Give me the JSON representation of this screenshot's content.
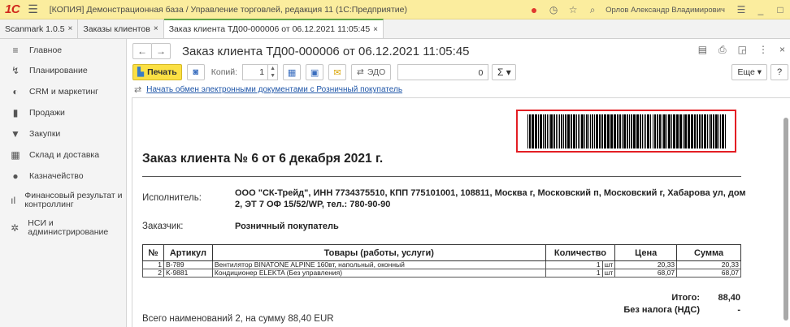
{
  "app": {
    "logo": "1С",
    "title": "[КОПИЯ] Демонстрационная база / Управление торговлей, редакция 11  (1С:Предприятие)",
    "user": "Орлов Александр Владимирович"
  },
  "tabs": [
    {
      "label": "Scanmark 1.0.5",
      "close": "×"
    },
    {
      "label": "Заказы клиентов",
      "close": "×"
    },
    {
      "label": "Заказ клиента ТД00-000006 от 06.12.2021 11:05:45",
      "close": "×"
    }
  ],
  "sidebar": {
    "items": [
      {
        "label": "Главное",
        "icon": "≡"
      },
      {
        "label": "Планирование",
        "icon": "↯"
      },
      {
        "label": "CRM и маркетинг",
        "icon": "◐"
      },
      {
        "label": "Продажи",
        "icon": "▮"
      },
      {
        "label": "Закупки",
        "icon": "▼"
      },
      {
        "label": "Склад и доставка",
        "icon": "▦"
      },
      {
        "label": "Казначейство",
        "icon": "●"
      },
      {
        "label": "Финансовый результат и контроллинг",
        "icon": "ıl"
      },
      {
        "label": "НСИ и администрирование",
        "icon": "✲"
      }
    ]
  },
  "doc": {
    "title": "Заказ клиента ТД00-000006 от 06.12.2021 11:05:45"
  },
  "toolbar": {
    "print_label": "Печать",
    "copies_label": "Копий:",
    "copies_value": "1",
    "edo_label": "ЭДО",
    "sum_value": "0",
    "sigma_label": "Σ ▾",
    "more_label": "Еще ▾",
    "help_label": "?"
  },
  "edo_link": "Начать обмен электронными документами с Розничный покупатель",
  "print": {
    "heading": "Заказ клиента № 6 от 6 декабря 2021 г.",
    "executor_label": "Исполнитель:",
    "executor_value": "ООО \"СК-Трейд\", ИНН 7734375510, КПП 775101001, 108811, Москва г, Московский п, Московский г, Хабарова ул, дом 2, ЭТ 7 ОФ 15/52/WP, тел.: 780-90-90",
    "customer_label": "Заказчик:",
    "customer_value": "Розничный покупатель",
    "table_headers": [
      "№",
      "Артикул",
      "Товары (работы, услуги)",
      "Количество",
      "Цена",
      "Сумма"
    ],
    "rows": [
      {
        "n": "1",
        "sku": "B-789",
        "name": "Вентилятор BINATONE ALPINE 160вт, напольный, оконный",
        "qty": "1",
        "unit": "шт",
        "price": "20,33",
        "sum": "20,33"
      },
      {
        "n": "2",
        "sku": "K-9881",
        "name": "Кондиционер ELEKTA (Без управления)",
        "qty": "1",
        "unit": "шт",
        "price": "68,07",
        "sum": "68,07"
      }
    ],
    "total_label": "Итого:",
    "total_value": "88,40",
    "vat_label": "Без налога (НДС)",
    "vat_value": "-",
    "summary": "Всего наименований 2, на сумму 88,40 EUR"
  },
  "colors": {
    "titlebar": "#fbed9e",
    "print_button": "#fbe044",
    "barcode_frame": "#e31e24",
    "link": "#1f56a8",
    "active_tab_accent": "#61a547"
  }
}
